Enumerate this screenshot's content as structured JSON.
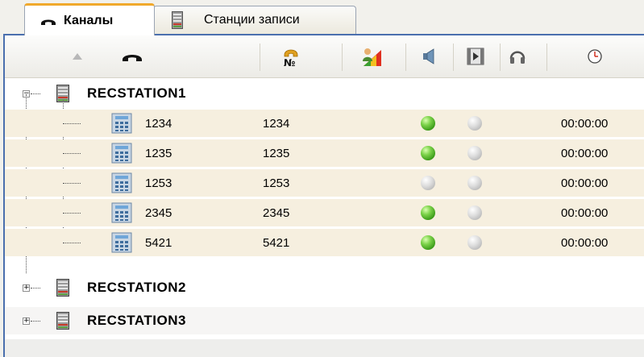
{
  "tabs": [
    {
      "label": "Каналы",
      "icon": "phone-handset-icon",
      "active": true
    },
    {
      "label": "Станции записи",
      "icon": "server-icon",
      "active": false
    }
  ],
  "columns": [
    {
      "icon": "sort-ascending-icon"
    },
    {
      "icon": "phone-handset-icon"
    },
    {
      "icon": "number-icon"
    },
    {
      "icon": "user-level-icon"
    },
    {
      "icon": "speaker-icon"
    },
    {
      "icon": "film-icon"
    },
    {
      "icon": "headphones-icon"
    },
    {
      "icon": "clock-icon"
    }
  ],
  "stations": [
    {
      "name": "RECSTATION1",
      "expanded": true,
      "channels": [
        {
          "name": "1234",
          "number": "1234",
          "status1": "green",
          "status2": "gray",
          "time": "00:00:00"
        },
        {
          "name": "1235",
          "number": "1235",
          "status1": "green",
          "status2": "gray",
          "time": "00:00:00"
        },
        {
          "name": "1253",
          "number": "1253",
          "status1": "gray",
          "status2": "gray",
          "time": "00:00:00"
        },
        {
          "name": "2345",
          "number": "2345",
          "status1": "green",
          "status2": "gray",
          "time": "00:00:00"
        },
        {
          "name": "5421",
          "number": "5421",
          "status1": "green",
          "status2": "gray",
          "time": "00:00:00"
        }
      ]
    },
    {
      "name": "RECSTATION2",
      "expanded": false,
      "channels": []
    },
    {
      "name": "RECSTATION3",
      "expanded": false,
      "channels": []
    }
  ],
  "colors": {
    "active_tab_accent": "#f0a92c",
    "panel_border": "#4a6fae",
    "channel_row_bg": "#f6efdf",
    "status_green": "#3a9a18",
    "status_gray": "#b4b4b4"
  }
}
